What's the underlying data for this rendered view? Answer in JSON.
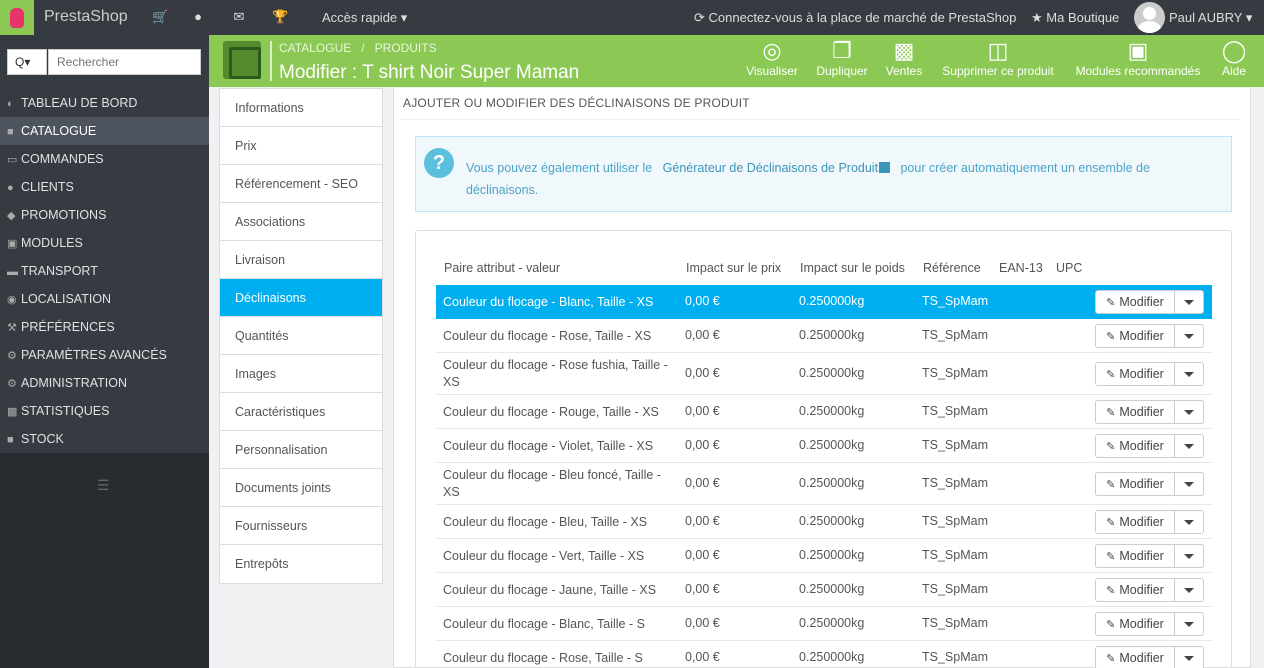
{
  "topbar": {
    "brand": "PrestaShop",
    "quick_access": "Accès rapide ▾",
    "marketplace": "Connectez-vous à la place de marché de PrestaShop",
    "shop": "Ma Boutique",
    "user": "Paul AUBRY ▾",
    "icons": [
      "cart-icon",
      "user-icon",
      "mail-icon",
      "trophy-icon"
    ]
  },
  "search": {
    "placeholder": "Rechercher",
    "button": "Q▾"
  },
  "sidebar": {
    "items": [
      {
        "label": "TABLEAU DE BORD",
        "icon": "dashboard-icon"
      },
      {
        "label": "CATALOGUE",
        "icon": "book-icon"
      },
      {
        "label": "COMMANDES",
        "icon": "credit-card-icon"
      },
      {
        "label": "CLIENTS",
        "icon": "users-icon"
      },
      {
        "label": "PROMOTIONS",
        "icon": "tag-icon"
      },
      {
        "label": "MODULES",
        "icon": "puzzle-icon"
      },
      {
        "label": "TRANSPORT",
        "icon": "truck-icon"
      },
      {
        "label": "LOCALISATION",
        "icon": "globe-icon"
      },
      {
        "label": "PRÉFÉRENCES",
        "icon": "wrench-icon"
      },
      {
        "label": "PARAMÈTRES AVANCÉS",
        "icon": "cogs-icon"
      },
      {
        "label": "ADMINISTRATION",
        "icon": "gear-icon"
      },
      {
        "label": "STATISTIQUES",
        "icon": "bar-chart-icon"
      },
      {
        "label": "STOCK",
        "icon": "archive-icon"
      }
    ]
  },
  "header": {
    "breadcrumb": [
      "CATALOGUE",
      "PRODUITS"
    ],
    "title": "Modifier : T shirt Noir Super Maman",
    "toolbar": [
      "Visualiser",
      "Dupliquer",
      "Ventes",
      "Supprimer ce produit",
      "Modules recommandés",
      "Aide"
    ]
  },
  "tabs": [
    "Informations",
    "Prix",
    "Référencement - SEO",
    "Associations",
    "Livraison",
    "Déclinaisons",
    "Quantités",
    "Images",
    "Caractéristiques",
    "Personnalisation",
    "Documents joints",
    "Fournisseurs",
    "Entrepôts"
  ],
  "panel": {
    "title": "AJOUTER OU MODIFIER DES DÉCLINAISONS DE PRODUIT",
    "info_before": "Vous pouvez également utiliser le",
    "info_link": "Générateur de Déclinaisons de Produit",
    "info_after": "pour créer automatiquement un ensemble de déclinaisons."
  },
  "table": {
    "headers": [
      "Paire attribut - valeur",
      "Impact sur le prix",
      "Impact sur le poids",
      "Référence",
      "EAN-13",
      "UPC"
    ],
    "edit_label": "Modifier",
    "rows": [
      {
        "attr": "Couleur du flocage - Blanc, Taille - XS",
        "price": "0,00 €",
        "weight": "0.250000kg",
        "ref": "TS_SpMam"
      },
      {
        "attr": "Couleur du flocage - Rose, Taille - XS",
        "price": "0,00 €",
        "weight": "0.250000kg",
        "ref": "TS_SpMam"
      },
      {
        "attr": "Couleur du flocage - Rose fushia, Taille - XS",
        "price": "0,00 €",
        "weight": "0.250000kg",
        "ref": "TS_SpMam"
      },
      {
        "attr": "Couleur du flocage - Rouge, Taille - XS",
        "price": "0,00 €",
        "weight": "0.250000kg",
        "ref": "TS_SpMam"
      },
      {
        "attr": "Couleur du flocage - Violet, Taille - XS",
        "price": "0,00 €",
        "weight": "0.250000kg",
        "ref": "TS_SpMam"
      },
      {
        "attr": "Couleur du flocage - Bleu foncé, Taille - XS",
        "price": "0,00 €",
        "weight": "0.250000kg",
        "ref": "TS_SpMam"
      },
      {
        "attr": "Couleur du flocage - Bleu, Taille - XS",
        "price": "0,00 €",
        "weight": "0.250000kg",
        "ref": "TS_SpMam"
      },
      {
        "attr": "Couleur du flocage - Vert, Taille - XS",
        "price": "0,00 €",
        "weight": "0.250000kg",
        "ref": "TS_SpMam"
      },
      {
        "attr": "Couleur du flocage - Jaune, Taille - XS",
        "price": "0,00 €",
        "weight": "0.250000kg",
        "ref": "TS_SpMam"
      },
      {
        "attr": "Couleur du flocage - Blanc, Taille - S",
        "price": "0,00 €",
        "weight": "0.250000kg",
        "ref": "TS_SpMam"
      },
      {
        "attr": "Couleur du flocage - Rose, Taille - S",
        "price": "0,00 €",
        "weight": "0.250000kg",
        "ref": "TS_SpMam"
      }
    ]
  },
  "colors": {
    "accent": "#8bc954",
    "selected": "#00aff0",
    "topbar": "#363a41"
  }
}
